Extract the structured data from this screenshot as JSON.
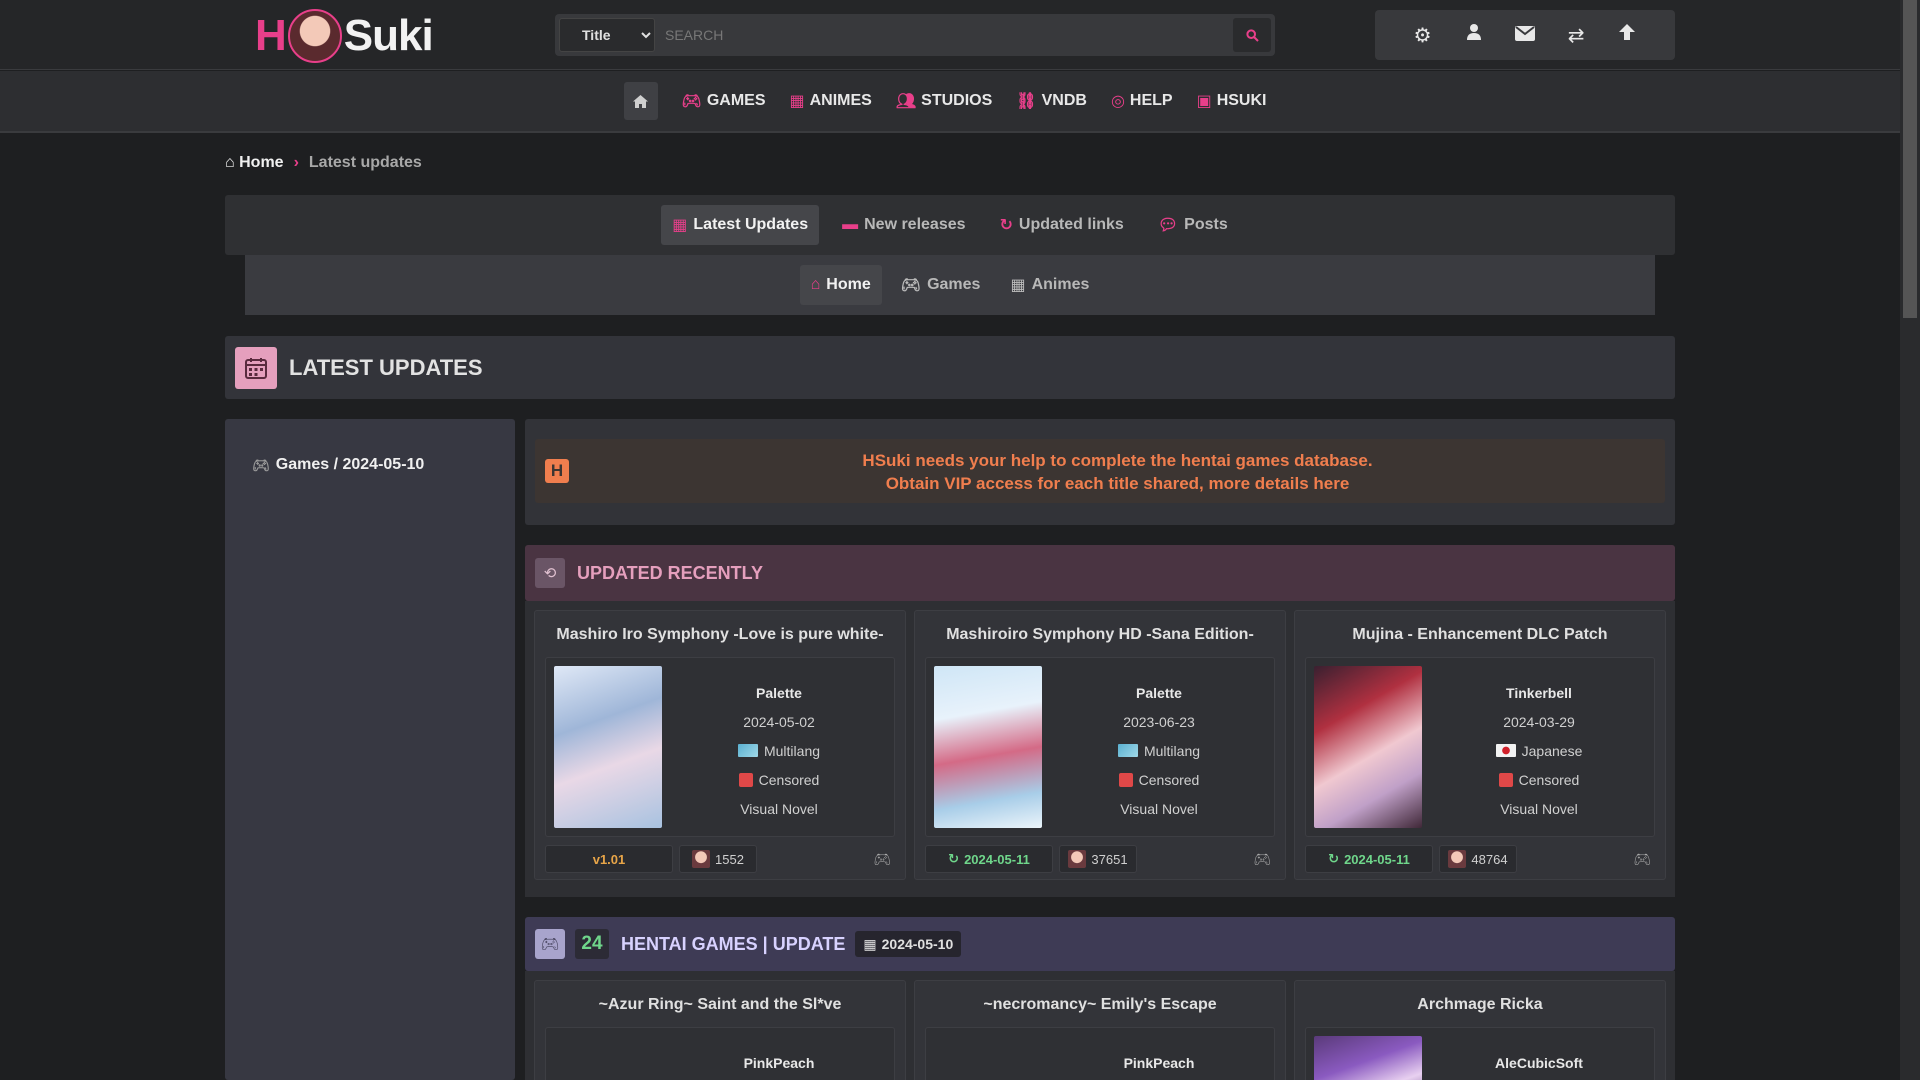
{
  "header": {
    "logo_h": "H",
    "logo_suki": "Suki",
    "search_select": "Title",
    "search_placeholder": "SEARCH",
    "icons": [
      "gear-icon",
      "user-icon",
      "envelope-icon",
      "shuffle-icon",
      "arrow-up-icon"
    ]
  },
  "nav": {
    "items": [
      {
        "label": "GAMES",
        "icon": "gamepad-icon"
      },
      {
        "label": "ANIMES",
        "icon": "film-icon"
      },
      {
        "label": "STUDIOS",
        "icon": "users-icon"
      },
      {
        "label": "VNDB",
        "icon": "vndb-icon"
      },
      {
        "label": "HELP",
        "icon": "lifebuoy-icon"
      },
      {
        "label": "HSUKI",
        "icon": "hsuki-icon"
      }
    ]
  },
  "breadcrumb": {
    "home": "Home",
    "current": "Latest updates"
  },
  "tabs_main": [
    {
      "label": "Latest Updates",
      "icon": "calendar-icon",
      "active": true
    },
    {
      "label": "New releases",
      "icon": "tag-icon",
      "active": false
    },
    {
      "label": "Updated links",
      "icon": "refresh-icon",
      "active": false
    },
    {
      "label": "Posts",
      "icon": "comments-icon",
      "active": false
    }
  ],
  "tabs_sub": [
    {
      "label": "Home",
      "icon": "home-icon",
      "active": true
    },
    {
      "label": "Games",
      "icon": "gamepad-icon",
      "active": false
    },
    {
      "label": "Animes",
      "icon": "film-icon",
      "active": false
    }
  ],
  "section": {
    "title": "LATEST UPDATES"
  },
  "sidebar": {
    "link": "Games / 2024-05-10"
  },
  "notice": {
    "line1": "HSuki needs your help to complete the hentai games database.",
    "line2": "Obtain VIP access for each title shared, more details here"
  },
  "recent": {
    "title": "UPDATED RECENTLY",
    "cards": [
      {
        "title": "Mashiro Iro Symphony -Love is pure white-",
        "studio": "Palette",
        "date": "2024-05-02",
        "language": "Multilang",
        "censor": "Censored",
        "genre": "Visual Novel",
        "badge": "v1.01",
        "views": "1552"
      },
      {
        "title": "Mashiroiro Symphony HD -Sana Edition-",
        "studio": "Palette",
        "date": "2023-06-23",
        "language": "Multilang",
        "censor": "Censored",
        "genre": "Visual Novel",
        "badge": "2024-05-11",
        "views": "37651"
      },
      {
        "title": "Mujina - Enhancement DLC Patch",
        "studio": "Tinkerbell",
        "date": "2024-03-29",
        "language": "Japanese",
        "censor": "Censored",
        "genre": "Visual Novel",
        "badge": "2024-05-11",
        "views": "48764"
      }
    ]
  },
  "hgames": {
    "count": "24",
    "title": "HENTAI GAMES | UPDATE",
    "date": "2024-05-10",
    "cards": [
      {
        "title": "~Azur Ring~ Saint and the Sl*ve",
        "studio": "PinkPeach"
      },
      {
        "title": "~necromancy~ Emily's Escape",
        "studio": "PinkPeach"
      },
      {
        "title": "Archmage Ricka",
        "studio": "AleCubicSoft"
      }
    ]
  },
  "colors": {
    "accent": "#e83f8a",
    "notice": "#f07e4e",
    "updated": "#6fd68b",
    "version": "#e8a548"
  }
}
